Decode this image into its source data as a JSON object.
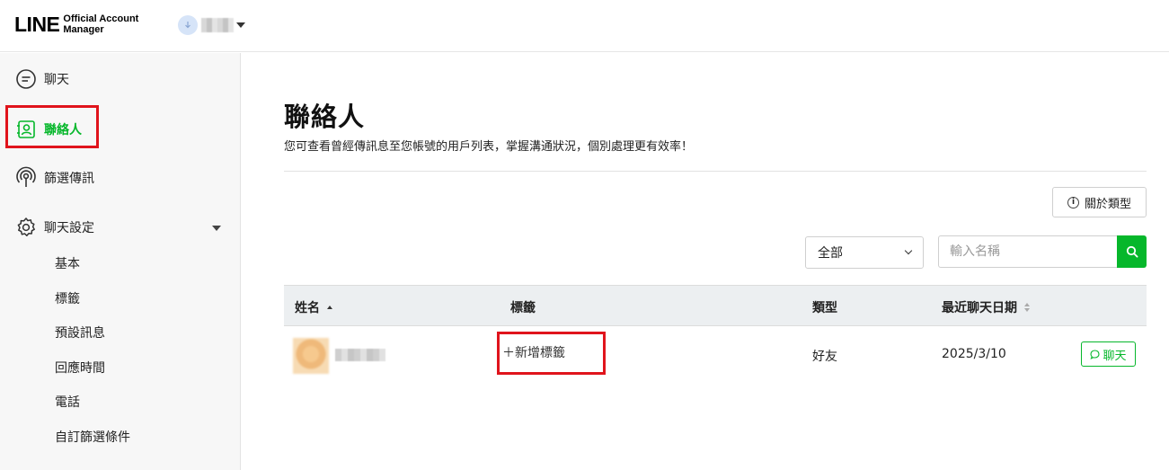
{
  "header": {
    "logo_main": "LINE",
    "logo_sub_1": "Official Account",
    "logo_sub_2": "Manager"
  },
  "sidebar": {
    "items": [
      {
        "label": "聊天",
        "icon": "chat-bubble-icon"
      },
      {
        "label": "聯絡人",
        "icon": "contact-card-icon",
        "active": true
      },
      {
        "label": "篩選傳訊",
        "icon": "broadcast-icon"
      },
      {
        "label": "聊天設定",
        "icon": "gear-icon",
        "expanded": true
      }
    ],
    "sub_items": [
      "基本",
      "標籤",
      "預設訊息",
      "回應時間",
      "電話",
      "自訂篩選條件"
    ]
  },
  "main": {
    "title": "聯絡人",
    "description": "您可查看曾經傳訊息至您帳號的用戶列表，掌握溝通狀況，個別處理更有效率！",
    "about_button": "關於類型",
    "filter_select": "全部",
    "search_placeholder": "輸入名稱",
    "table": {
      "headers": [
        "姓名",
        "標籤",
        "類型",
        "最近聊天日期"
      ],
      "rows": [
        {
          "tag_action": "＋新增標籤",
          "type": "好友",
          "date": "2025/3/10",
          "action": "聊天"
        }
      ]
    }
  },
  "colors": {
    "accent": "#06b72b",
    "highlight": "#e0141c",
    "sidebar_bg": "#f7f7f7",
    "table_header_bg": "#eceff1"
  }
}
